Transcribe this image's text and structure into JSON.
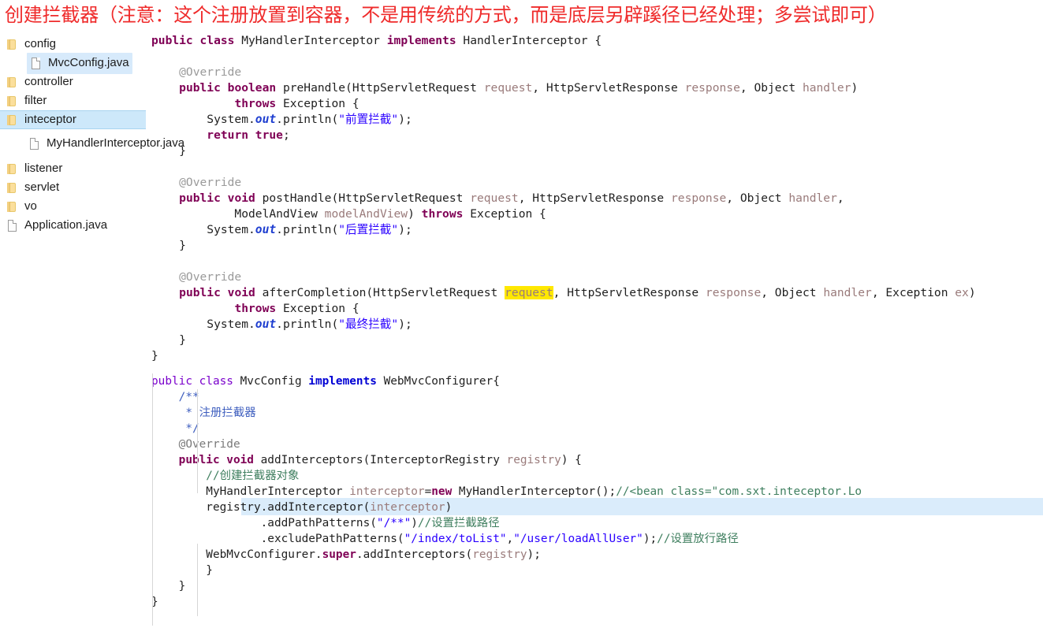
{
  "title": "创建拦截器（注意：这个注册放置到容器，不是用传统的方式，而是底层另辟蹊径已经处理；多尝试即可）",
  "colors": {
    "title_red": "#ef2b2b",
    "tree_selection": "#cde8fa",
    "code_selection": "#daecfb",
    "search_highlight": "#ffe800",
    "keyword": "#7f0055",
    "string": "#2a00ff",
    "comment": "#3f7f5f",
    "parameter": "#9a7b7b",
    "annotation": "#9a9a9a",
    "class_violet": "#7a00cc",
    "implements_blue": "#0000d4",
    "folder_icon": "#fbdf9c"
  },
  "sidebar": {
    "items": [
      {
        "label": "config",
        "icon": "folder-icon",
        "indent": 0,
        "state": "normal"
      },
      {
        "label": "MvcConfig.java",
        "icon": "file-icon",
        "indent": 1,
        "state": "file-selected"
      },
      {
        "label": "controller",
        "icon": "folder-icon",
        "indent": 0,
        "state": "normal"
      },
      {
        "label": "filter",
        "icon": "folder-icon",
        "indent": 0,
        "state": "normal"
      },
      {
        "label": "inteceptor",
        "icon": "folder-icon",
        "indent": 0,
        "state": "folder-selected"
      },
      {
        "label": "MyHandlerInterceptor.java",
        "icon": "file-icon",
        "indent": 1,
        "state": "normal"
      },
      {
        "label": "listener",
        "icon": "folder-icon",
        "indent": 0,
        "state": "normal"
      },
      {
        "label": "servlet",
        "icon": "folder-icon",
        "indent": 0,
        "state": "normal"
      },
      {
        "label": "vo",
        "icon": "folder-icon",
        "indent": 0,
        "state": "normal"
      },
      {
        "label": "Application.java",
        "icon": "file-icon",
        "indent": 0,
        "state": "normal"
      }
    ]
  },
  "code_a": {
    "language": "java",
    "lines": [
      {
        "n": 1,
        "segments": [
          {
            "t": "public ",
            "c": "kw"
          },
          {
            "t": "class ",
            "c": "kw"
          },
          {
            "t": "MyHandlerInterceptor ",
            "c": "typ"
          },
          {
            "t": "implements ",
            "c": "kw"
          },
          {
            "t": "HandlerInterceptor {",
            "c": "typ"
          }
        ]
      },
      {
        "n": 2,
        "segments": []
      },
      {
        "n": 3,
        "segments": [
          {
            "t": "    @Override",
            "c": "anno"
          }
        ]
      },
      {
        "n": 4,
        "segments": [
          {
            "t": "    ",
            "c": "id"
          },
          {
            "t": "public boolean ",
            "c": "kw"
          },
          {
            "t": "preHandle(HttpServletRequest ",
            "c": "typ"
          },
          {
            "t": "request",
            "c": "par"
          },
          {
            "t": ", HttpServletResponse ",
            "c": "typ"
          },
          {
            "t": "response",
            "c": "par"
          },
          {
            "t": ", Object ",
            "c": "typ"
          },
          {
            "t": "handler",
            "c": "par"
          },
          {
            "t": ")",
            "c": "typ"
          }
        ]
      },
      {
        "n": 5,
        "segments": [
          {
            "t": "            ",
            "c": "id"
          },
          {
            "t": "throws ",
            "c": "kw"
          },
          {
            "t": "Exception {",
            "c": "typ"
          }
        ]
      },
      {
        "n": 6,
        "segments": [
          {
            "t": "        System.",
            "c": "id"
          },
          {
            "t": "out",
            "c": "fld"
          },
          {
            "t": ".println(",
            "c": "id"
          },
          {
            "t": "\"前置拦截\"",
            "c": "str"
          },
          {
            "t": ");",
            "c": "id"
          }
        ]
      },
      {
        "n": 7,
        "segments": [
          {
            "t": "        ",
            "c": "id"
          },
          {
            "t": "return true",
            "c": "kw"
          },
          {
            "t": ";",
            "c": "id"
          }
        ]
      },
      {
        "n": 8,
        "segments": [
          {
            "t": "    }",
            "c": "id"
          }
        ]
      },
      {
        "n": 9,
        "segments": []
      },
      {
        "n": 10,
        "segments": [
          {
            "t": "    @Override",
            "c": "anno"
          }
        ]
      },
      {
        "n": 11,
        "segments": [
          {
            "t": "    ",
            "c": "id"
          },
          {
            "t": "public void ",
            "c": "kw"
          },
          {
            "t": "postHandle(HttpServletRequest ",
            "c": "typ"
          },
          {
            "t": "request",
            "c": "par"
          },
          {
            "t": ", HttpServletResponse ",
            "c": "typ"
          },
          {
            "t": "response",
            "c": "par"
          },
          {
            "t": ", Object ",
            "c": "typ"
          },
          {
            "t": "handler",
            "c": "par"
          },
          {
            "t": ",",
            "c": "typ"
          }
        ]
      },
      {
        "n": 12,
        "segments": [
          {
            "t": "            ModelAndView ",
            "c": "typ"
          },
          {
            "t": "modelAndView",
            "c": "par"
          },
          {
            "t": ") ",
            "c": "typ"
          },
          {
            "t": "throws ",
            "c": "kw"
          },
          {
            "t": "Exception {",
            "c": "typ"
          }
        ]
      },
      {
        "n": 13,
        "segments": [
          {
            "t": "        System.",
            "c": "id"
          },
          {
            "t": "out",
            "c": "fld"
          },
          {
            "t": ".println(",
            "c": "id"
          },
          {
            "t": "\"后置拦截\"",
            "c": "str"
          },
          {
            "t": ");",
            "c": "id"
          }
        ]
      },
      {
        "n": 14,
        "segments": [
          {
            "t": "    }",
            "c": "id"
          }
        ]
      },
      {
        "n": 15,
        "segments": []
      },
      {
        "n": 16,
        "segments": [
          {
            "t": "    @Override",
            "c": "anno"
          }
        ]
      },
      {
        "n": 17,
        "segments": [
          {
            "t": "    ",
            "c": "id"
          },
          {
            "t": "public void ",
            "c": "kw"
          },
          {
            "t": "afterCompletion(HttpServletRequest ",
            "c": "typ"
          },
          {
            "t": "request",
            "c": "hlq par"
          },
          {
            "t": ", HttpServletResponse ",
            "c": "typ"
          },
          {
            "t": "response",
            "c": "par"
          },
          {
            "t": ", Object ",
            "c": "typ"
          },
          {
            "t": "handler",
            "c": "par"
          },
          {
            "t": ", Exception ",
            "c": "typ"
          },
          {
            "t": "ex",
            "c": "par"
          },
          {
            "t": ")",
            "c": "typ"
          }
        ]
      },
      {
        "n": 18,
        "segments": [
          {
            "t": "            ",
            "c": "id"
          },
          {
            "t": "throws ",
            "c": "kw"
          },
          {
            "t": "Exception {",
            "c": "typ"
          }
        ]
      },
      {
        "n": 19,
        "segments": [
          {
            "t": "        System.",
            "c": "id"
          },
          {
            "t": "out",
            "c": "fld"
          },
          {
            "t": ".println(",
            "c": "id"
          },
          {
            "t": "\"最终拦截\"",
            "c": "str"
          },
          {
            "t": ");",
            "c": "id"
          }
        ]
      },
      {
        "n": 20,
        "segments": [
          {
            "t": "    }",
            "c": "id"
          }
        ]
      },
      {
        "n": 21,
        "segments": [
          {
            "t": "}",
            "c": "id"
          }
        ]
      }
    ]
  },
  "code_b": {
    "language": "java",
    "lines": [
      {
        "n": 1,
        "segments": [
          {
            "t": "public class ",
            "c": "kw2"
          },
          {
            "t": "MvcConfig ",
            "c": "id"
          },
          {
            "t": "implements ",
            "c": "kwb"
          },
          {
            "t": "WebMvcConfigurer{",
            "c": "id"
          }
        ]
      },
      {
        "n": 2,
        "segments": [
          {
            "t": "    /**",
            "c": "jdoc"
          }
        ]
      },
      {
        "n": 3,
        "segments": [
          {
            "t": "     * 注册拦截器",
            "c": "jdoc"
          }
        ]
      },
      {
        "n": 4,
        "segments": [
          {
            "t": "     */",
            "c": "jdoc"
          }
        ]
      },
      {
        "n": 5,
        "segments": [
          {
            "t": "    @Override",
            "c": "anno2"
          }
        ]
      },
      {
        "n": 6,
        "segments": [
          {
            "t": "    ",
            "c": "id"
          },
          {
            "t": "public void ",
            "c": "kw3"
          },
          {
            "t": "addInterceptors(InterceptorRegistry ",
            "c": "id"
          },
          {
            "t": "registry",
            "c": "par2"
          },
          {
            "t": ") {",
            "c": "id"
          }
        ]
      },
      {
        "n": 7,
        "segments": [
          {
            "t": "        //创建拦截器对象",
            "c": "cmt"
          }
        ]
      },
      {
        "n": 8,
        "selected": true,
        "segments": [
          {
            "t": "        MyHandlerInterceptor ",
            "c": "id"
          },
          {
            "t": "interceptor",
            "c": "par2"
          },
          {
            "t": "=",
            "c": "id"
          },
          {
            "t": "new ",
            "c": "kw3"
          },
          {
            "t": "MyHandlerInterceptor();",
            "c": "id"
          },
          {
            "t": "//<bean class=\"com.sxt.inteceptor.Lo",
            "c": "cmt"
          }
        ]
      },
      {
        "n": 9,
        "segments": [
          {
            "t": "        registry.addInterceptor(",
            "c": "id"
          },
          {
            "t": "interceptor",
            "c": "par2"
          },
          {
            "t": ")",
            "c": "id"
          }
        ]
      },
      {
        "n": 10,
        "segments": [
          {
            "t": "                .addPathPatterns(",
            "c": "id"
          },
          {
            "t": "\"/**\"",
            "c": "str2"
          },
          {
            "t": ")",
            "c": "id"
          },
          {
            "t": "//设置拦截路径",
            "c": "cmt"
          }
        ]
      },
      {
        "n": 11,
        "segments": [
          {
            "t": "                .excludePathPatterns(",
            "c": "id"
          },
          {
            "t": "\"/index/toList\"",
            "c": "str2"
          },
          {
            "t": ",",
            "c": "id"
          },
          {
            "t": "\"/user/loadAllUser\"",
            "c": "str2"
          },
          {
            "t": ");",
            "c": "id"
          },
          {
            "t": "//设置放行路径",
            "c": "cmt"
          }
        ]
      },
      {
        "n": 12,
        "segments": [
          {
            "t": "        WebMvcConfigurer.",
            "c": "id"
          },
          {
            "t": "super",
            "c": "kw3"
          },
          {
            "t": ".addInterceptors(",
            "c": "id"
          },
          {
            "t": "registry",
            "c": "par2"
          },
          {
            "t": ");",
            "c": "id"
          }
        ]
      },
      {
        "n": 13,
        "segments": [
          {
            "t": "        }",
            "c": "id"
          }
        ]
      },
      {
        "n": 14,
        "segments": [
          {
            "t": "    }",
            "c": "id"
          }
        ]
      },
      {
        "n": 15,
        "segments": [
          {
            "t": "}",
            "c": "id"
          }
        ]
      }
    ]
  }
}
